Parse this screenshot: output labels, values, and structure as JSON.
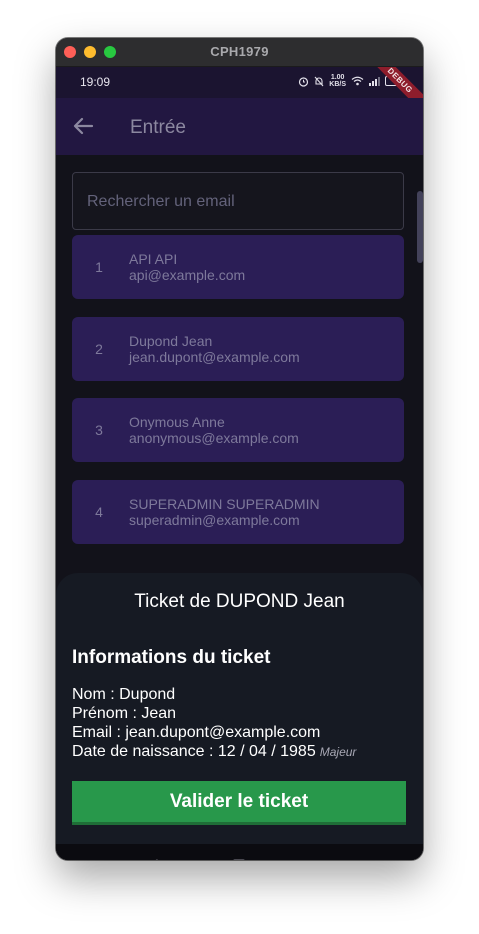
{
  "window": {
    "title": "CPH1979"
  },
  "status": {
    "time": "19:09",
    "net_speed_value": "1.00",
    "net_speed_unit": "KB/S",
    "battery": "50"
  },
  "debug_banner": "DEBUG",
  "appbar": {
    "title": "Entrée",
    "back_icon": "arrow-left-icon"
  },
  "search": {
    "placeholder": "Rechercher un email",
    "value": ""
  },
  "users": [
    {
      "index": "1",
      "name": "API API",
      "email": "api@example.com"
    },
    {
      "index": "2",
      "name": "Dupond Jean",
      "email": "jean.dupont@example.com"
    },
    {
      "index": "3",
      "name": "Onymous Anne",
      "email": "anonymous@example.com"
    },
    {
      "index": "4",
      "name": "SUPERADMIN SUPERADMIN",
      "email": "superadmin@example.com"
    }
  ],
  "sheet": {
    "title": "Ticket de DUPOND Jean",
    "subtitle": "Informations du ticket",
    "nom": "Nom : Dupond",
    "prenom": "Prénom : Jean",
    "email": "Email : jean.dupont@example.com",
    "naissance": "Date de naissance : 12 / 04 / 1985",
    "majeur_badge": "Majeur",
    "validate_label": "Valider le ticket"
  },
  "navbar": {
    "back_icon": "triangle-back-icon",
    "home_icon": "square-home-icon",
    "menu_icon": "menu-lines-icon"
  },
  "colors": {
    "appbar": "#221741",
    "card": "#2b1e56",
    "sheet": "#161a23",
    "validate_button": "#28984b",
    "debug_ribbon": "#8e1d2c"
  }
}
